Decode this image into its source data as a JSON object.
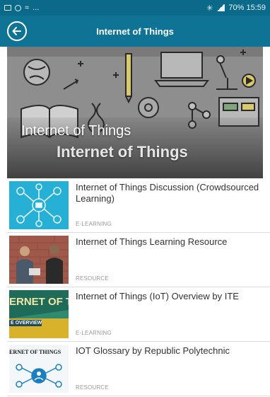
{
  "status_bar": {
    "left_text": "...",
    "right_text": "70% 15:59"
  },
  "app_bar": {
    "title": "Internet of Things",
    "back_icon": "back-arrow-circle-icon"
  },
  "hero": {
    "title_light": "Internet of Things",
    "title_bold": "Internet of Things"
  },
  "items": [
    {
      "title": "Internet of Things Discussion (Crowdsourced Learning)",
      "type": "E-LEARNING"
    },
    {
      "title": "Internet of Things Learning Resource",
      "type": "RESOURCE"
    },
    {
      "title": "Internet of Things (IoT) Overview by ITE",
      "type": "E-LEARNING",
      "thumb_big": "ERNET OF T",
      "thumb_small": "E OVERVIEW"
    },
    {
      "title": "IOT Glossary by Republic Polytechnic",
      "type": "RESOURCE",
      "thumb_text": "ERNET OF THINGS"
    }
  ],
  "colors": {
    "status_bar": "#0b6a89",
    "app_bar": "#0e7394",
    "hero_bg": "#8a8a8a"
  }
}
